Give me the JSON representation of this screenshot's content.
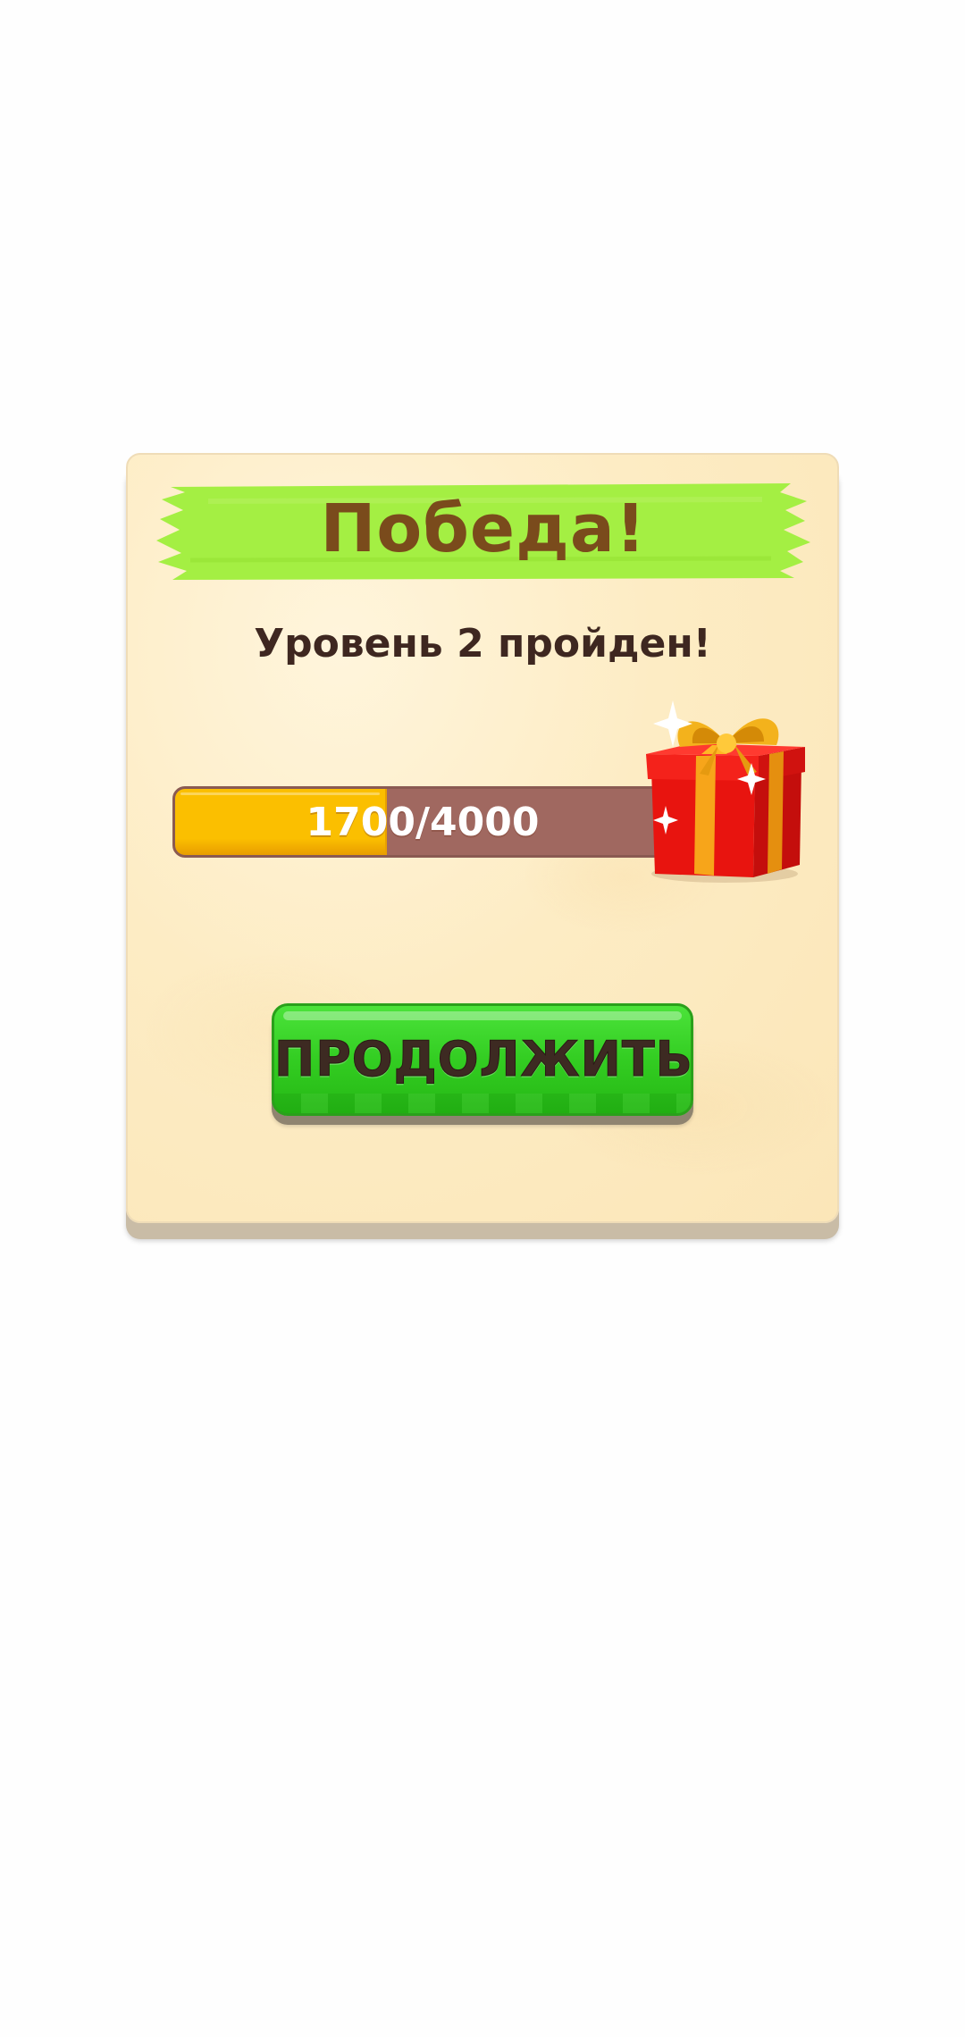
{
  "dialog": {
    "title": "Победа!",
    "subtitle": "Уровень 2 пройден!",
    "progress": {
      "current": 1700,
      "total": 4000,
      "label": "1700/4000"
    },
    "reward_icon": "gift-box-icon",
    "continue_label": "ПРОДОЛЖИТЬ"
  },
  "colors": {
    "banner": "#a4ef43",
    "title_text": "#7a4b1c",
    "progress_fill": "#fbbf00",
    "progress_track": "#a06860",
    "button_green": "#33cd22",
    "panel": "#fdecc4"
  }
}
